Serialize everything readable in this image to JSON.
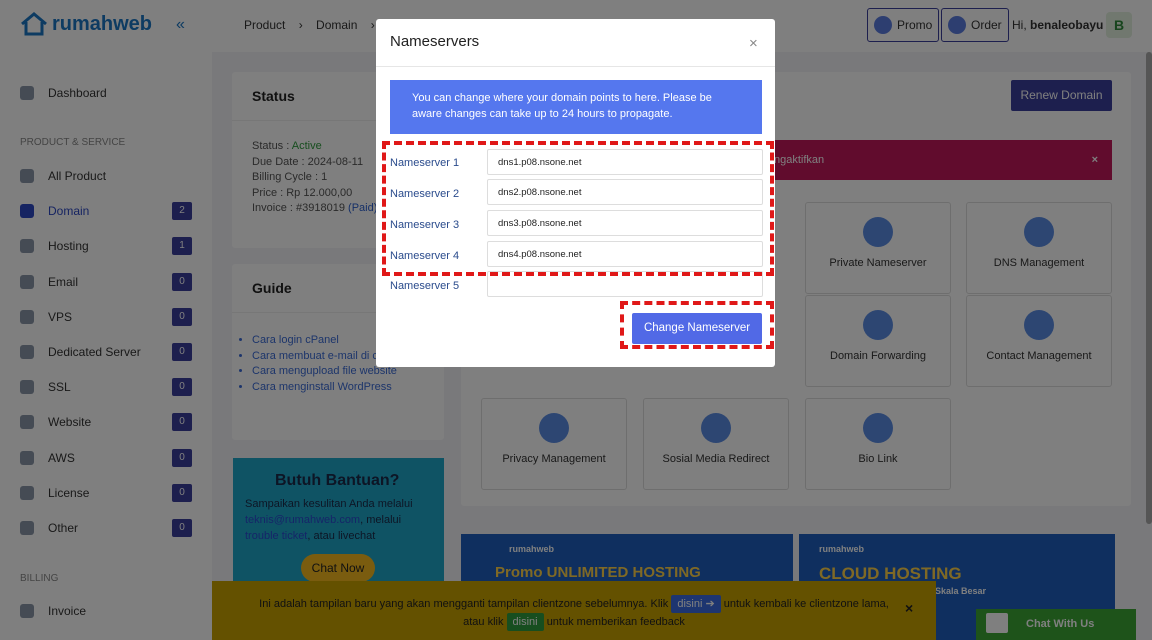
{
  "brand": {
    "name": "rumahweb",
    "collapse_glyph": "«"
  },
  "sidebar": {
    "items_top": [
      {
        "label": "Dashboard"
      }
    ],
    "section1": "PRODUCT & SERVICE",
    "items": [
      {
        "label": "All Product",
        "count": ""
      },
      {
        "label": "Domain",
        "count": "2"
      },
      {
        "label": "Hosting",
        "count": "1"
      },
      {
        "label": "Email",
        "count": "0"
      },
      {
        "label": "VPS",
        "count": "0"
      },
      {
        "label": "Dedicated Server",
        "count": "0"
      },
      {
        "label": "SSL",
        "count": "0"
      },
      {
        "label": "Website",
        "count": "0"
      },
      {
        "label": "AWS",
        "count": "0"
      },
      {
        "label": "License",
        "count": "0"
      },
      {
        "label": "Other",
        "count": "0"
      }
    ],
    "section2": "BILLING",
    "billing_items": [
      {
        "label": "Invoice"
      }
    ]
  },
  "topbar": {
    "crumbs": [
      "Product",
      "›",
      "Domain",
      "›"
    ],
    "promo": "Promo",
    "order": "Order",
    "hi": "Hi,",
    "user": "benaleobayu",
    "avatar": "B"
  },
  "status_card": {
    "title": "Status",
    "status_label": "Status :",
    "status_value": "Active",
    "due": "Due Date : 2024-08-11",
    "cycle": "Billing Cycle : 1",
    "price": "Price : Rp 12.000,00",
    "invoice": "Invoice : #3918019",
    "invoice_state": "(Paid)"
  },
  "guide": {
    "title": "Guide",
    "links": [
      "Cara login cPanel",
      "Cara membuat e-mail di cPanel",
      "Cara mengupload file website",
      "Cara menginstall WordPress"
    ]
  },
  "help": {
    "title": "Butuh Bantuan?",
    "line1": "Sampaikan kesulitan Anda melalui",
    "email": "teknis@rumahweb.com",
    "line2": ", melalui",
    "ticket": "trouble ticket",
    "line3": ", atau livechat",
    "cta": "Chat Now"
  },
  "domain_actions": {
    "renew": "Renew Domain",
    "alert": "ngaktifkan",
    "alert_close": "×",
    "tiles": [
      "Private Nameserver",
      "DNS Management",
      "Domain Forwarding",
      "Contact Management",
      "Privacy Management",
      "Sosial Media Redirect",
      "Bio Link"
    ]
  },
  "banners": [
    {
      "brand": "rumahweb",
      "text": "Promo UNLIMITED HOSTING"
    },
    {
      "brand": "rumahweb",
      "text": "CLOUD HOSTING",
      "sub": "Skala Besar"
    }
  ],
  "notice": {
    "text1": "Ini adalah tampilan baru yang akan mengganti tampilan clientzone sebelumnya. Klik",
    "btn1": "disini ➔",
    "text2": "untuk kembali ke clientzone lama,",
    "text3": "atau klik",
    "btn2": "disini",
    "text4": "untuk memberikan feedback",
    "close": "×"
  },
  "chat": {
    "label": "Chat With Us"
  },
  "modal": {
    "title": "Nameservers",
    "close": "×",
    "info": "You can change where your domain points to here. Please be aware changes can take up to 24 hours to propagate.",
    "nameservers": [
      {
        "label": "Nameserver 1",
        "value": "dns1.p08.nsone.net"
      },
      {
        "label": "Nameserver 2",
        "value": "dns2.p08.nsone.net"
      },
      {
        "label": "Nameserver 3",
        "value": "dns3.p08.nsone.net"
      },
      {
        "label": "Nameserver 4",
        "value": "dns4.p08.nsone.net"
      },
      {
        "label": "Nameserver 5",
        "value": ""
      }
    ],
    "submit": "Change Nameserver"
  },
  "colors": {
    "accent": "#3b3f9c",
    "highlight": "#e01818",
    "info": "#5577ee"
  }
}
